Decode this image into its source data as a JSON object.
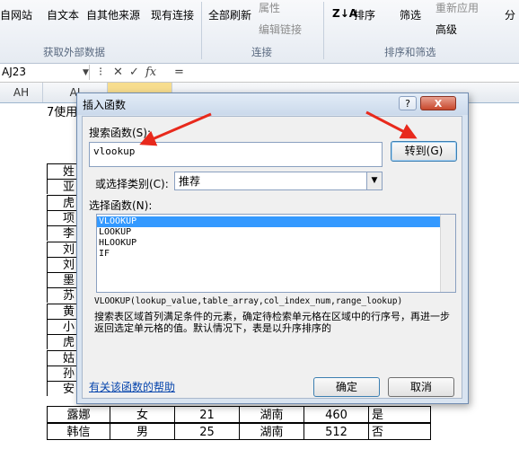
{
  "ribbon": {
    "from_web": "自网站",
    "from_text": "自文本",
    "from_other": "自其他来源",
    "existing_connections": "现有连接",
    "refresh_all": "全部刷新",
    "properties": "属性",
    "edit_links": "编辑链接",
    "sort": "排序",
    "filter": "筛选",
    "reapply": "重新应用",
    "advanced": "高级",
    "divide": "分",
    "group_external": "获取外部数据",
    "group_connections": "连接",
    "group_sort_filter": "排序和筛选"
  },
  "formula_bar": {
    "name_box": "AJ23",
    "fx": "fx",
    "formula": "="
  },
  "columns": {
    "ah": "AH",
    "ai": "AI"
  },
  "sheet": {
    "title_fragment": "7使用",
    "left_chars": [
      "姓",
      "亚",
      "虎",
      "项",
      "李",
      "刘",
      "刘",
      "墨",
      "苏",
      "黄",
      "小",
      "虎",
      "姑",
      "孙",
      "安"
    ],
    "rows": [
      [
        "露娜",
        "女",
        "21",
        "湖南",
        "460",
        "是"
      ],
      [
        "韩信",
        "男",
        "25",
        "湖南",
        "512",
        "否"
      ]
    ]
  },
  "dialog": {
    "title": "插入函数",
    "help_btn": "?",
    "close_btn": "X",
    "search_label": "搜索函数(S):",
    "search_value": "vlookup",
    "goto_btn": "转到(G)",
    "category_label": "或选择类别(C):",
    "category_value": "推荐",
    "select_label": "选择函数(N):",
    "functions": [
      "VLOOKUP",
      "LOOKUP",
      "HLOOKUP",
      "IF"
    ],
    "signature": "VLOOKUP(lookup_value,table_array,col_index_num,range_lookup)",
    "description": "搜索表区域首列满足条件的元素，确定待检索单元格在区域中的行序号，再进一步返回选定单元格的值。默认情况下，表是以升序排序的",
    "help_link": "有关该函数的帮助",
    "ok": "确定",
    "cancel": "取消"
  },
  "colors": {
    "arrow": "#e8291c",
    "selection": "#3399ff"
  }
}
